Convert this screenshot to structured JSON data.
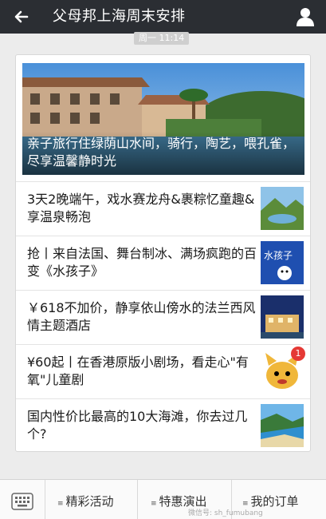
{
  "header": {
    "title": "父母邦上海周末安排",
    "back_icon": "back-arrow-icon",
    "user_icon": "user-icon"
  },
  "timestamp": "周一 11:14",
  "hero": {
    "caption": "亲子旅行住绿荫山水间，骑行，陶艺，喂孔雀，尽享温馨静时光"
  },
  "articles": [
    {
      "title": "3天2晚端午，戏水赛龙舟&裹粽忆童趣&享温泉畅泡"
    },
    {
      "title": "抢丨来自法国、舞台制冰、满场疯跑的百变《水孩子》",
      "thumb_text": "水孩子"
    },
    {
      "title": "￥618不加价，静享依山傍水的法兰西风情主题酒店"
    },
    {
      "title": "¥60起丨在香港原版小剧场，看走心\"有氧\"儿童剧",
      "badge": "1"
    },
    {
      "title": "国内性价比最高的10大海滩，你去过几个?"
    }
  ],
  "bottom_menu": {
    "tabs": [
      {
        "label": "精彩活动"
      },
      {
        "label": "特惠演出"
      },
      {
        "label": "我的订单"
      }
    ],
    "watermark": "微信号: sh_fumubang"
  }
}
